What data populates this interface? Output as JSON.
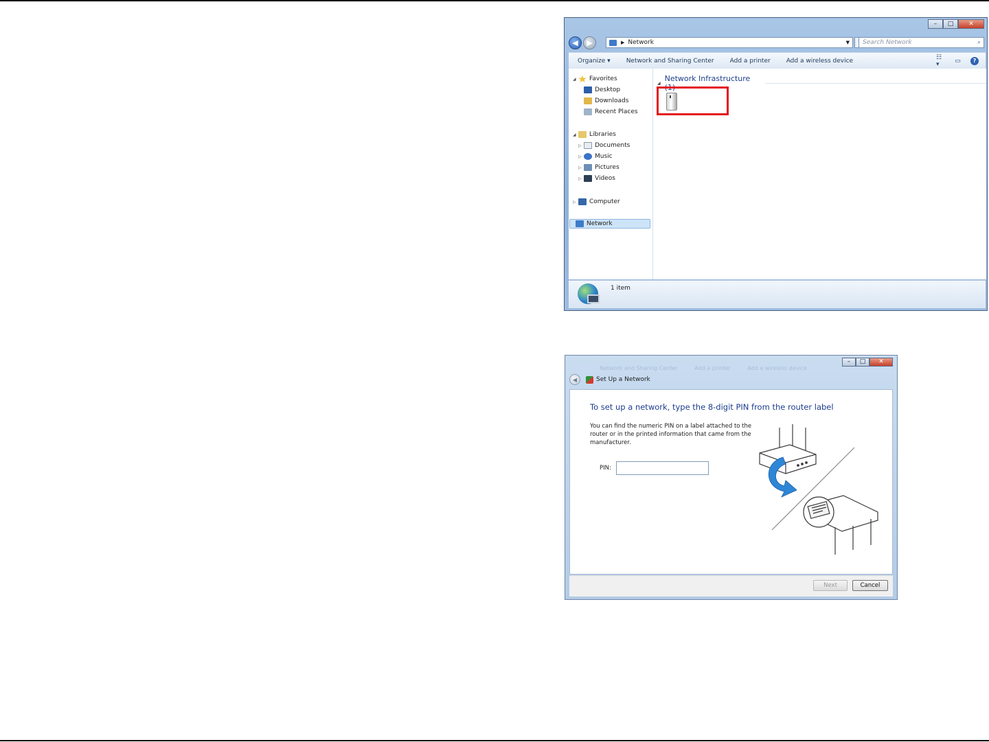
{
  "explorer": {
    "address": "Network",
    "search_placeholder": "Search Network",
    "toolbar": {
      "organize": "Organize ▾",
      "sharing_center": "Network and Sharing Center",
      "add_printer": "Add a printer",
      "add_wireless": "Add a wireless device"
    },
    "nav": {
      "favorites": "Favorites",
      "desktop": "Desktop",
      "downloads": "Downloads",
      "recent": "Recent Places",
      "libraries": "Libraries",
      "documents": "Documents",
      "music": "Music",
      "pictures": "Pictures",
      "videos": "Videos",
      "computer": "Computer",
      "network": "Network"
    },
    "group_header": "Network Infrastructure (1)",
    "status": "1 item",
    "highlight_color": "#e3141c"
  },
  "dialog": {
    "title": "Set Up a Network",
    "heading": "To set up a network, type the 8-digit PIN from the router label",
    "description": "You can find the numeric PIN on a label attached to the router or in the printed information that came from the manufacturer.",
    "pin_label": "PIN:",
    "pin_value": "",
    "next_button": "Next",
    "cancel_button": "Cancel",
    "background_ghost": [
      "Network and Sharing Center",
      "Add a printer",
      "Add a wireless device"
    ]
  }
}
